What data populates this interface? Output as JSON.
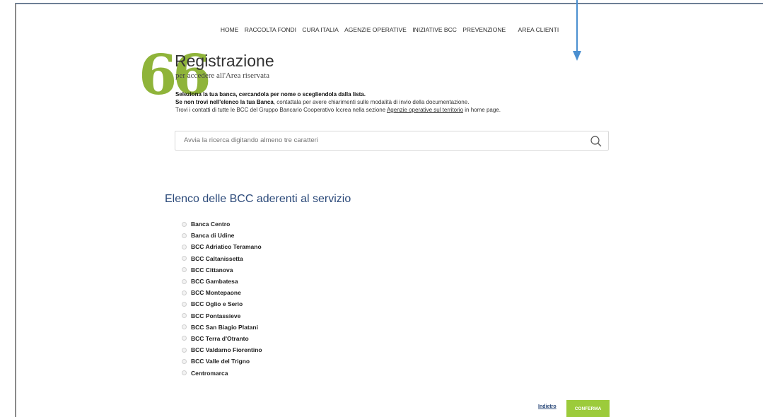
{
  "nav": {
    "items": [
      "HOME",
      "RACCOLTA FONDI",
      "CURA ITALIA",
      "AGENZIE OPERATIVE",
      "INIZIATIVE BCC",
      "PREVENZIONE"
    ],
    "clients": "AREA CLIENTI"
  },
  "header": {
    "title": "Registrazione",
    "subtitle": "per accedere all'Area riservata"
  },
  "intro": {
    "line1": "Seleziona la tua banca, cercandola per nome o scegliendola dalla lista.",
    "line2_bold": "Se non trovi nell'elenco la tua Banca",
    "line2_rest": ", contattala per avere chiarimenti sulle modalità di invio della documentazione.",
    "line3_pre": "Trovi i contatti di tutte le BCC del Gruppo Bancario Cooperativo Iccrea nella sezione ",
    "line3_link": "Agenzie operative sul territorio",
    "line3_post": " in home page."
  },
  "search": {
    "placeholder": "Avvia la ricerca digitando almeno tre caratteri"
  },
  "list": {
    "title": "Elenco delle BCC aderenti al servizio",
    "banks": [
      "Banca Centro",
      "Banca di Udine",
      "BCC Adriatico Teramano",
      "BCC Caltanissetta",
      "BCC Cittanova",
      "BCC Gambatesa",
      "BCC Montepaone",
      "BCC Oglio e Serio",
      "BCC Pontassieve",
      "BCC San Biagio Platani",
      "BCC Terra d'Otranto",
      "BCC Valdarno Fiorentino",
      "BCC Valle del Trigno",
      "Centromarca"
    ]
  },
  "actions": {
    "back": "Indietro",
    "confirm": "CONFERMA"
  },
  "colors": {
    "accent_green": "#9ccb3b",
    "quote_green": "#8fb43a",
    "heading_blue": "#2c4a7a",
    "annotation_blue": "#4a8fd0"
  }
}
